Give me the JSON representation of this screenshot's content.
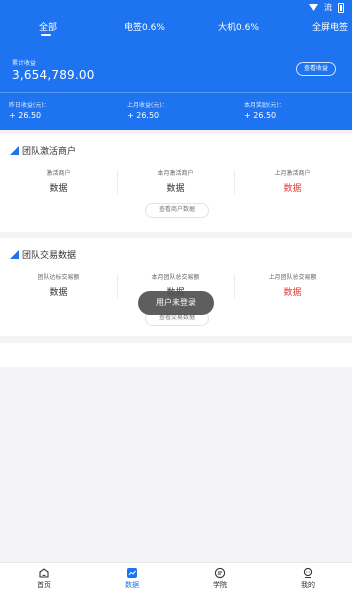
{
  "status_bar": {
    "signal_text": "流"
  },
  "tabs": [
    {
      "label": "全部",
      "active": true
    },
    {
      "label": "电签0.6%"
    },
    {
      "label": "大机0.6%"
    },
    {
      "label": "全屏电签"
    }
  ],
  "earnings": {
    "total_label": "累计收益",
    "total_value": "3,654,789.00",
    "view_button": "查看收益",
    "stats": [
      {
        "label": "昨日收益(元)：",
        "value": "+ 26.50"
      },
      {
        "label": "上月收益(元)：",
        "value": "+ 26.50"
      },
      {
        "label": "本月奖励(元)：",
        "value": "+ 26.50"
      }
    ]
  },
  "activation_card": {
    "title": "团队激活商户",
    "columns": [
      {
        "label": "激活商户",
        "value": "数据"
      },
      {
        "label": "本月激活商户",
        "value": "数据"
      },
      {
        "label": "上月激活商户",
        "value": "数据"
      }
    ],
    "button": "查看商户数据"
  },
  "trade_card": {
    "title": "团队交易数据",
    "columns": [
      {
        "label": "团队达标交易额",
        "value": "数据"
      },
      {
        "label": "本月团队总交易额",
        "value": "数据"
      },
      {
        "label": "上月团队总交易额",
        "value": "数据"
      }
    ],
    "button": "查看交易数据"
  },
  "toast": {
    "text": "用户未登录"
  },
  "bottom_nav": [
    {
      "label": "首页",
      "icon": "home-icon"
    },
    {
      "label": "数据",
      "icon": "chart-icon",
      "active": true
    },
    {
      "label": "学院",
      "icon": "academy-icon"
    },
    {
      "label": "我的",
      "icon": "profile-icon"
    }
  ],
  "colors": {
    "accent": "#1e73f0",
    "highlight": "#e53935"
  }
}
